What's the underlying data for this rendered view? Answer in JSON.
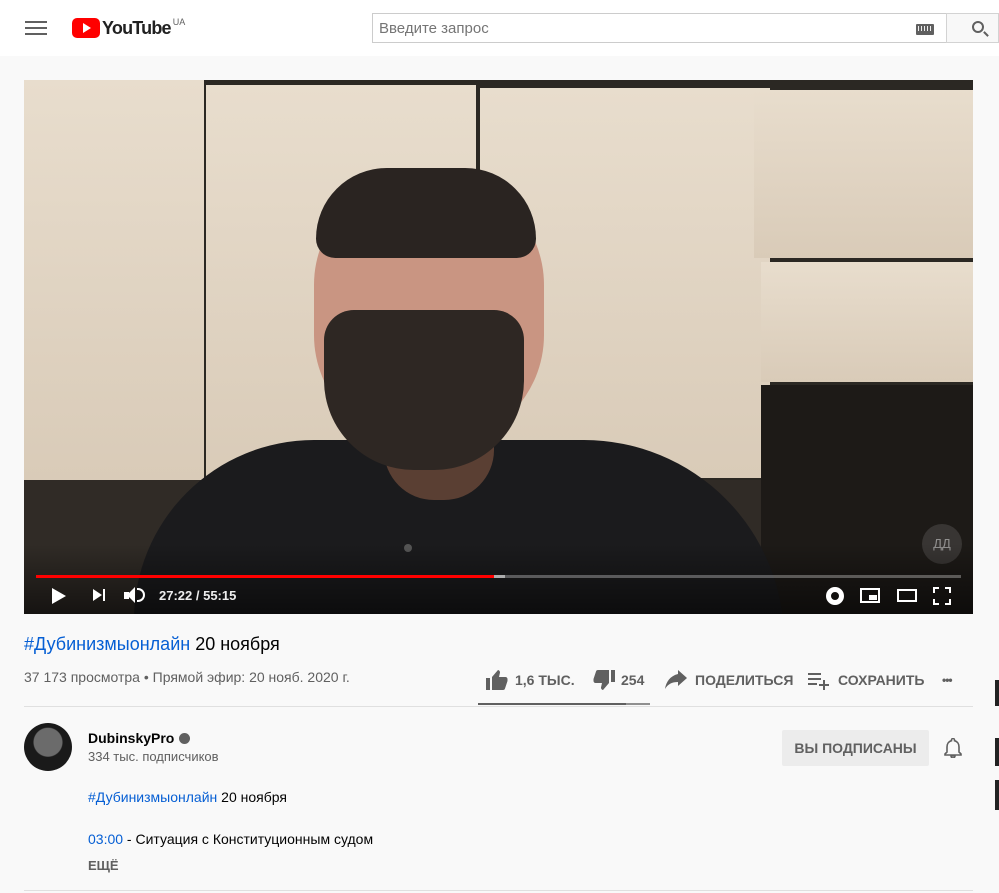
{
  "masthead": {
    "logo_text": "YouTube",
    "country_code": "UA",
    "search_placeholder": "Введите запрос"
  },
  "player": {
    "current_time": "27:22",
    "duration": "55:15",
    "time_display": "27:22 / 55:15",
    "progress_fraction": 0.495,
    "buffered_fraction": 0.507,
    "watermark": "ДД"
  },
  "video": {
    "title_hashtag": "#Дубинизмыонлайн",
    "title_rest": " 20 ноября",
    "views": "37 173 просмотра",
    "live_info": " • Прямой эфир: 20 нояб. 2020 г.",
    "likes": "1,6 ТЫС.",
    "dislikes": "254",
    "like_fraction": 0.863,
    "share_label": "ПОДЕЛИТЬСЯ",
    "save_label": "СОХРАНИТЬ",
    "more_label": "•••"
  },
  "channel": {
    "name": "DubinskyPro",
    "subscribers": "334 тыс. подписчиков",
    "subscribed_label": "ВЫ ПОДПИСАНЫ"
  },
  "description": {
    "line1_hashtag": "#Дубинизмыонлайн",
    "line1_rest": " 20 ноября",
    "line2_timestamp": "03:00",
    "line2_rest": " - Ситуация с Конституционным судом",
    "more_label": "ЕЩЁ"
  },
  "colors": {
    "brand_red": "#ff0000",
    "link_blue": "#065fd4"
  }
}
